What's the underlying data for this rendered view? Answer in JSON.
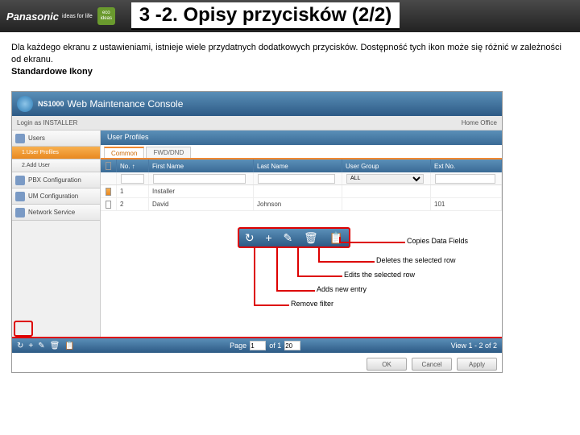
{
  "header": {
    "brand": "Panasonic",
    "tag": "ideas for life",
    "eco": "eco ideas",
    "title": "3 -2. Opisy przycisków (2/2)"
  },
  "intro": {
    "p1": "Dla każdego ekranu z ustawieniami, istnieje wiele przydatnych dodatkowych przycisków. Dostępność tych ikon może się różnić w zależności od ekranu.",
    "p2": "Standardowe Ikony"
  },
  "app": {
    "model": "NS1000",
    "console": "Web Maintenance Console",
    "login": "Login as INSTALLER",
    "home": "Home Office"
  },
  "sidebar": [
    "Users",
    "1.User Profiles",
    "2.Add User",
    "PBX Configuration",
    "UM Configuration",
    "Network Service"
  ],
  "panel": {
    "title": "User Profiles",
    "tabs": [
      "Common",
      "FWD/DND"
    ],
    "cols": [
      "",
      "No. ↑",
      "First Name",
      "Last Name",
      "User Group",
      "Ext No."
    ],
    "filter_all": "ALL"
  },
  "rows": [
    {
      "no": "1",
      "first": "Installer",
      "last": "",
      "group": "",
      "ext": ""
    },
    {
      "no": "2",
      "first": "David",
      "last": "Johnson",
      "group": "",
      "ext": "101"
    }
  ],
  "toolbar": {
    "refresh": "↻",
    "add": "+",
    "edit": "✎",
    "del": "🗑",
    "copy": "📋"
  },
  "callouts": {
    "copy": "Copies Data Fields",
    "del": "Deletes the selected row",
    "edit": "Edits the selected row",
    "add": "Adds new entry",
    "refresh": "Remove filter"
  },
  "footer": {
    "page_lbl": "Page",
    "of": "of 1",
    "view": "View 1 - 2 of 2"
  },
  "buttons": {
    "ok": "OK",
    "cancel": "Cancel",
    "apply": "Apply"
  }
}
